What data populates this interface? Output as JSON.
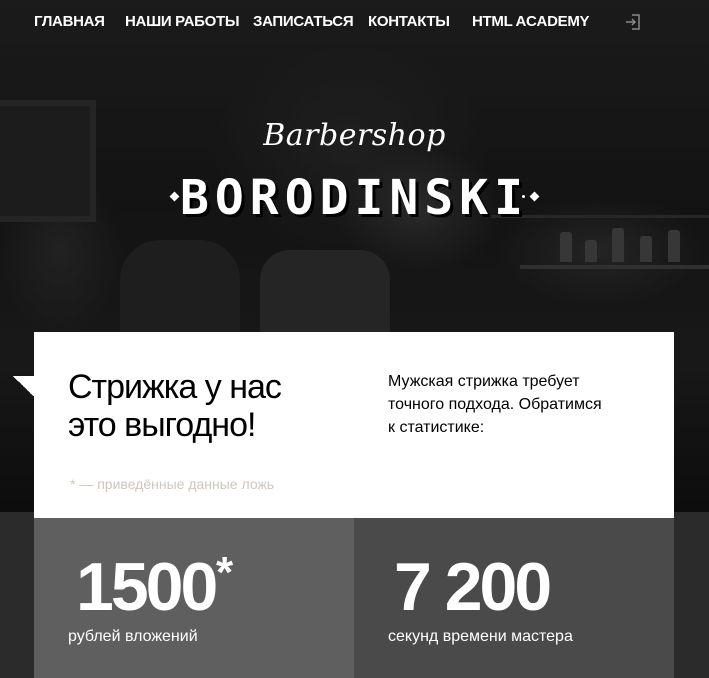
{
  "nav": {
    "items": [
      "ГЛАВНАЯ",
      "НАШИ РАБОТЫ",
      "ЗАПИСАТЬСЯ",
      "КОНТАКТЫ",
      "HTML ACADEMY"
    ]
  },
  "logo": {
    "script": "Barbershop",
    "main": "BORODINSKI"
  },
  "promo": {
    "title_line1": "Стрижка у нас",
    "title_line2": "это выгодно!",
    "note": "* — приведённые данные ложь",
    "text_line1": "Мужская стрижка требует",
    "text_line2": "точного подхода. Обратимся",
    "text_line3": "к статистике:"
  },
  "stats": [
    {
      "value": "1500",
      "star": "*",
      "label": "рублей вложений"
    },
    {
      "value": "7 200",
      "label": "секунд времени мастера"
    }
  ]
}
